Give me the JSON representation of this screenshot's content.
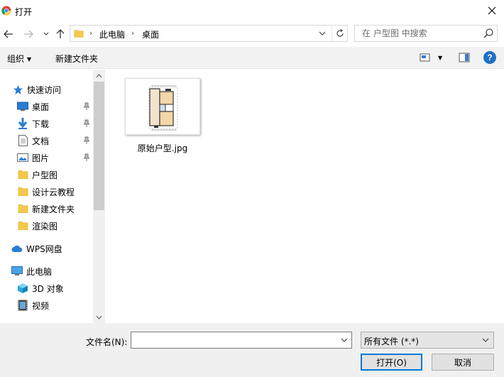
{
  "window": {
    "title": "打开"
  },
  "address": {
    "crumbs": [
      "此电脑",
      "桌面"
    ]
  },
  "search": {
    "placeholder": "在 户型图 中搜索"
  },
  "toolbar": {
    "organize": "组织",
    "new_folder": "新建文件夹"
  },
  "sidebar": {
    "quick_access": "快速访问",
    "items": [
      {
        "label": "桌面",
        "icon": "desktop-icon",
        "pinned": true
      },
      {
        "label": "下载",
        "icon": "download-icon",
        "pinned": true
      },
      {
        "label": "文档",
        "icon": "document-icon",
        "pinned": true
      },
      {
        "label": "图片",
        "icon": "picture-icon",
        "pinned": true
      },
      {
        "label": "户型图",
        "icon": "folder-icon",
        "pinned": false
      },
      {
        "label": "设计云教程",
        "icon": "folder-icon",
        "pinned": false
      },
      {
        "label": "新建文件夹",
        "icon": "folder-icon",
        "pinned": false
      },
      {
        "label": "渲染图",
        "icon": "folder-icon",
        "pinned": false
      }
    ],
    "wps": "WPS网盘",
    "this_pc": "此电脑",
    "pc_items": [
      {
        "label": "3D 对象",
        "icon": "3d-objects-icon"
      },
      {
        "label": "视频",
        "icon": "video-icon"
      }
    ]
  },
  "files": [
    {
      "name": "原始户型.jpg"
    }
  ],
  "bottom": {
    "filename_label": "文件名(N):",
    "filename_value": "",
    "filetype": "所有文件 (*.*)",
    "open_button": "打开(O)",
    "cancel_button": "取消"
  },
  "colors": {
    "folder": "#f5c84c",
    "accent": "#0078d7",
    "help": "#1f6fc8"
  }
}
